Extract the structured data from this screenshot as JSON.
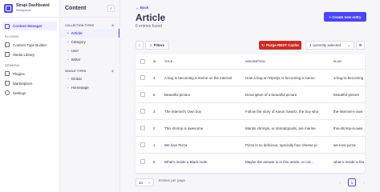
{
  "brand": {
    "title": "Strapi Dashboard",
    "subtitle": "Workplace"
  },
  "nav": {
    "active": "Content Manager",
    "plugins_label": "PLUGINS",
    "plugins": [
      "Content-Type Builder",
      "Media Library"
    ],
    "general_label": "GENERAL",
    "general": [
      "Plugins",
      "Marketplace",
      "Settings"
    ]
  },
  "cm": {
    "title": "Content",
    "collection_label": "COLLECTION TYPES",
    "collection_count": "4",
    "collection": [
      "Article",
      "Category",
      "User",
      "Writer"
    ],
    "single_label": "SINGLE TYPES",
    "single_count": "2",
    "single": [
      "Global",
      "Homepage"
    ]
  },
  "main": {
    "back": "Back",
    "title": "Article",
    "subtitle": "6 entries found",
    "create": "+ Create new entry",
    "filters": "Filters",
    "purge": "Purge REST Cache",
    "selected": "4 currently selected"
  },
  "table": {
    "headers": {
      "id": "ID",
      "title": "TITLE",
      "description": "DESCRIPTION",
      "slug": "SLUG"
    },
    "rows": [
      {
        "id": "4",
        "title": "A bug is becoming a meme on the internet",
        "description": "How a bug on MySQL is becoming a meme",
        "slug": "a-bug-is-becoming"
      },
      {
        "id": "5",
        "title": "Beautiful picture",
        "description": "Description of a beautiful picture",
        "slug": "beautiful-picture"
      },
      {
        "id": "3",
        "title": "The internet's Own boy",
        "description": "Follow the story of Aaron Swartz, the boy who",
        "slug": "the-internet-s-own"
      },
      {
        "id": "2",
        "title": "This shrimp is awesome",
        "description": "Mantis shrimps, or stomatopods, are marine",
        "slug": "this-shrimp-is-awe"
      },
      {
        "id": "1",
        "title": "We love Pizza",
        "description": "Pizza is so delicious, specially four cheese pi",
        "slug": "we-love-pizza"
      },
      {
        "id": "6",
        "title": "What's inside a Black Hole",
        "description": "Maybe the answer is in this article, or not...",
        "slug": "what-s-inside-a-bla"
      }
    ]
  },
  "pagination": {
    "per_page": "10",
    "label": "Entries per page",
    "current": "1"
  }
}
